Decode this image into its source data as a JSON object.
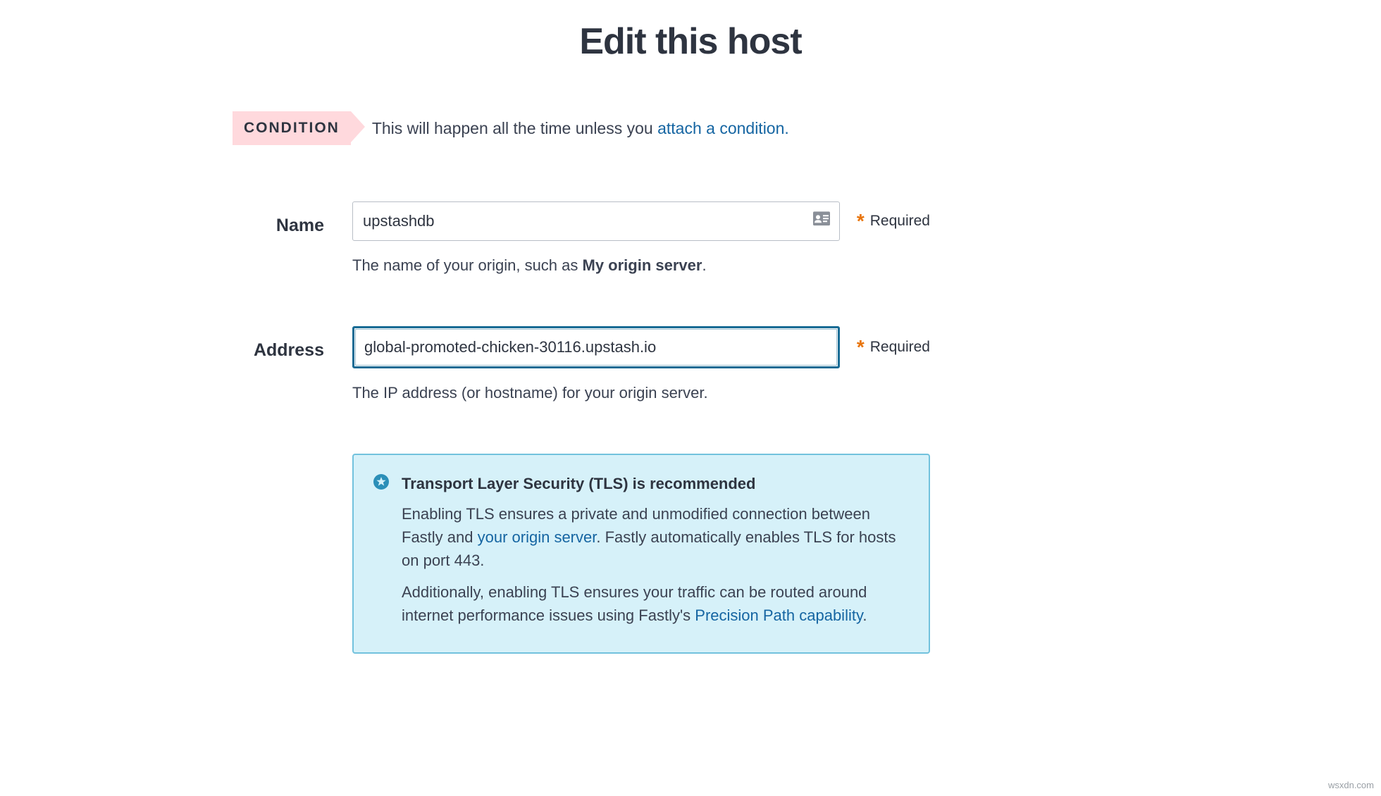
{
  "page": {
    "title": "Edit this host"
  },
  "condition": {
    "tag": "CONDITION",
    "text_before": "This will happen all the time unless you ",
    "link_text": "attach a condition.",
    "text_after": ""
  },
  "fields": {
    "name": {
      "label": "Name",
      "value": "upstashdb",
      "required_label": "Required",
      "help_prefix": "The name of your origin, such as ",
      "help_bold": "My origin server",
      "help_suffix": "."
    },
    "address": {
      "label": "Address",
      "value": "global-promoted-chicken-30116.upstash.io",
      "required_label": "Required",
      "help": "The IP address (or hostname) for your origin server."
    }
  },
  "info_box": {
    "title": "Transport Layer Security (TLS) is recommended",
    "p1_before": "Enabling TLS ensures a private and unmodified connection between Fastly and ",
    "p1_link": "your origin server",
    "p1_after": ". Fastly automatically enables TLS for hosts on port 443.",
    "p2_before": "Additionally, enabling TLS ensures your traffic can be routed around internet performance issues using Fastly's ",
    "p2_link": "Precision Path capability",
    "p2_after": "."
  },
  "watermark": "wsxdn.com"
}
